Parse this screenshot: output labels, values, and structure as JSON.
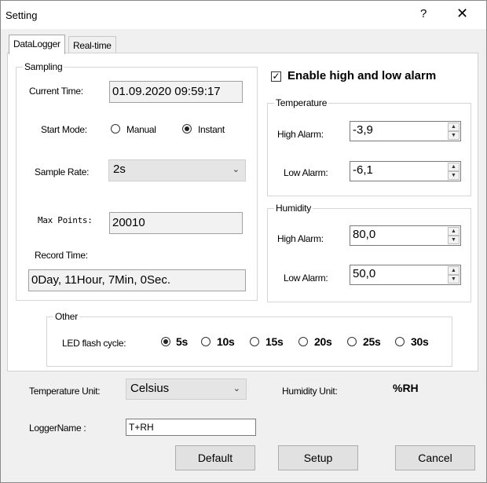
{
  "window": {
    "title": "Setting",
    "help": "?",
    "close": "✕"
  },
  "tabs": [
    {
      "label": "DataLogger"
    },
    {
      "label": "Real-time"
    }
  ],
  "sampling": {
    "legend": "Sampling",
    "current_time_label": "Current Time:",
    "current_time": "01.09.2020 09:59:17",
    "start_mode_label": "Start Mode:",
    "start_mode_options": [
      "Manual",
      "Instant"
    ],
    "start_mode_selected": "Instant",
    "sample_rate_label": "Sample Rate:",
    "sample_rate": "2s",
    "max_points_label": "Max Points:",
    "max_points": "20010",
    "record_time_label": "Record Time:",
    "record_time": "0Day, 11Hour, 7Min, 0Sec."
  },
  "alarm": {
    "enable_label": "Enable high and low alarm",
    "enabled": true,
    "temperature": {
      "legend": "Temperature",
      "high_label": "High Alarm:",
      "high": "-3,9",
      "low_label": "Low Alarm:",
      "low": "-6,1"
    },
    "humidity": {
      "legend": "Humidity",
      "high_label": "High Alarm:",
      "high": "80,0",
      "low_label": "Low Alarm:",
      "low": "50,0"
    }
  },
  "other": {
    "legend": "Other",
    "led_label": "LED flash cycle:",
    "led_options": [
      "5s",
      "10s",
      "15s",
      "20s",
      "25s",
      "30s"
    ],
    "led_selected": "5s"
  },
  "bottom": {
    "temp_unit_label": "Temperature Unit:",
    "temp_unit": "Celsius",
    "humidity_unit_label": "Humidity Unit:",
    "humidity_unit": "%RH",
    "logger_name_label": "LoggerName :",
    "logger_name": "T+RH"
  },
  "buttons": {
    "default": "Default",
    "setup": "Setup",
    "cancel": "Cancel"
  }
}
